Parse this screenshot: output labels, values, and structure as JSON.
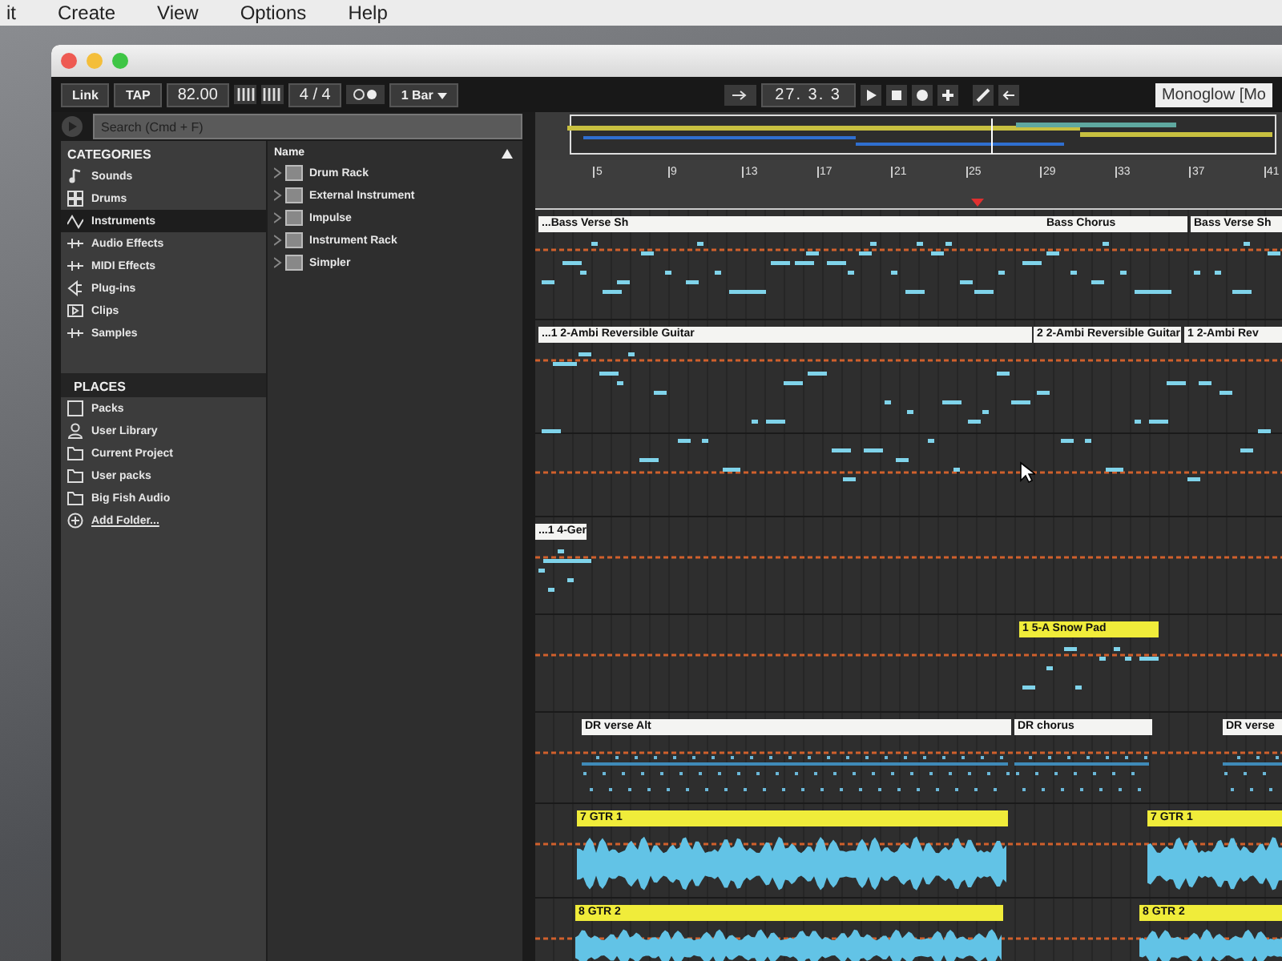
{
  "menu_bar": [
    "it",
    "Create",
    "View",
    "Options",
    "Help"
  ],
  "window": {
    "title": "Monoglow [Mo"
  },
  "control_bar": {
    "link": "Link",
    "tap": "TAP",
    "tempo": "82.00",
    "signature": "4 / 4",
    "quantize": "1 Bar",
    "position": "27.  3.  3"
  },
  "browser": {
    "search": {
      "placeholder": "Search (Cmd + F)"
    },
    "categories_heading": "CATEGORIES",
    "categories": [
      {
        "label": "Sounds",
        "selected": false
      },
      {
        "label": "Drums",
        "selected": false
      },
      {
        "label": "Instruments",
        "selected": true
      },
      {
        "label": "Audio Effects",
        "selected": false
      },
      {
        "label": "MIDI Effects",
        "selected": false
      },
      {
        "label": "Plug-ins",
        "selected": false
      },
      {
        "label": "Clips",
        "selected": false
      },
      {
        "label": "Samples",
        "selected": false
      }
    ],
    "places_heading": "PLACES",
    "places": [
      {
        "label": "Packs",
        "kind": "place"
      },
      {
        "label": "User Library",
        "kind": "place"
      },
      {
        "label": "Current Project",
        "kind": "place"
      },
      {
        "label": "User packs",
        "kind": "place"
      },
      {
        "label": "Big Fish Audio",
        "kind": "place"
      },
      {
        "label": "Add Folder...",
        "kind": "link"
      }
    ],
    "name_column": "Name",
    "items": [
      "Drum Rack",
      "External Instrument",
      "Impulse",
      "Instrument Rack",
      "Simpler"
    ]
  },
  "arrangement": {
    "ruler": [
      "5",
      "9",
      "13",
      "17",
      "21",
      "25",
      "29",
      "33",
      "37",
      "41"
    ],
    "tracks": [
      {
        "clips": [
          {
            "name": "...Bass Verse Sh",
            "color": "#f4f4f2",
            "kind": "midi"
          },
          {
            "name": "Bass Chorus",
            "color": "#f4f4f2",
            "kind": "midi"
          },
          {
            "name": "Bass Verse Sh",
            "color": "#f4f4f2",
            "kind": "midi"
          }
        ]
      },
      {
        "clips": [
          {
            "name": "...1 2-Ambi Reversible Guitar",
            "color": "#f4f4f2",
            "kind": "midi"
          },
          {
            "name": "2 2-Ambi Reversible Guitar",
            "color": "#f4f4f2",
            "kind": "midi"
          },
          {
            "name": "1 2-Ambi Rev",
            "color": "#f4f4f2",
            "kind": "midi"
          }
        ]
      },
      {
        "clips": [
          {
            "name": "...1 4-Ger",
            "color": "#f4f4f2",
            "kind": "midi"
          }
        ]
      },
      {
        "clips": [
          {
            "name": "1 5-A Snow Pad",
            "color": "#f0ec3a",
            "kind": "midi"
          }
        ]
      },
      {
        "clips": [
          {
            "name": "DR verse Alt",
            "color": "#f4f4f2",
            "kind": "drums"
          },
          {
            "name": "DR chorus",
            "color": "#f4f4f2",
            "kind": "drums"
          },
          {
            "name": "DR verse",
            "color": "#f4f4f2",
            "kind": "drums"
          }
        ]
      },
      {
        "clips": [
          {
            "name": "7 GTR 1",
            "color": "#f0ec3a",
            "kind": "audio"
          },
          {
            "name": "7 GTR 1",
            "color": "#f0ec3a",
            "kind": "audio"
          }
        ]
      },
      {
        "clips": [
          {
            "name": "8 GTR 2",
            "color": "#f0ec3a",
            "kind": "audio"
          },
          {
            "name": "8 GTR 2",
            "color": "#f0ec3a",
            "kind": "audio"
          }
        ]
      }
    ]
  }
}
